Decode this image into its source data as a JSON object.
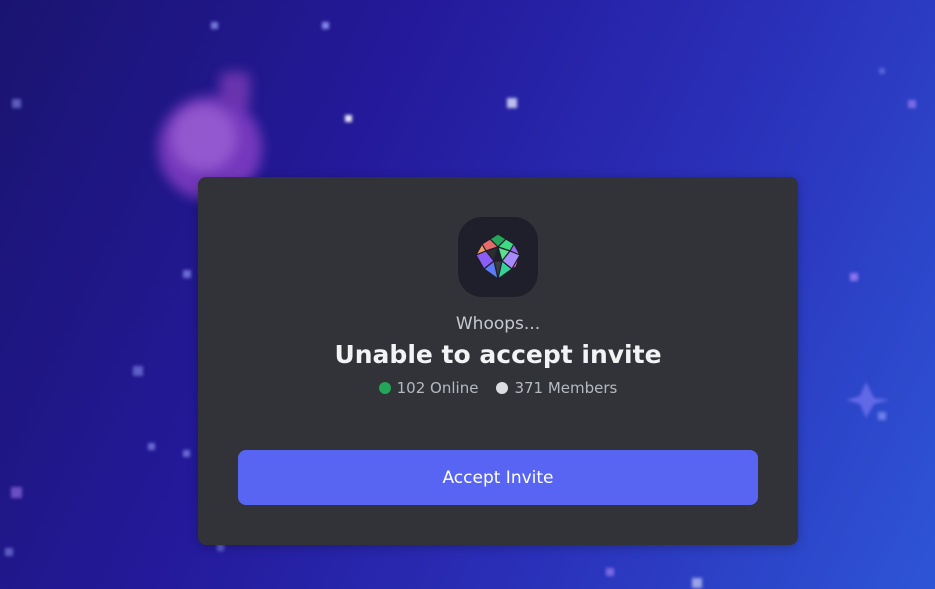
{
  "invite": {
    "subtitle": "Whoops...",
    "title": "Unable to accept invite",
    "online_count": "102 Online",
    "member_count": "371 Members",
    "accept_label": "Accept Invite",
    "server_icon": "crystal-gem-icon"
  },
  "colors": {
    "card_background": "#313338",
    "button_accent": "#5865f2",
    "online_status": "#23a55a",
    "members_status": "#dcdde1"
  }
}
